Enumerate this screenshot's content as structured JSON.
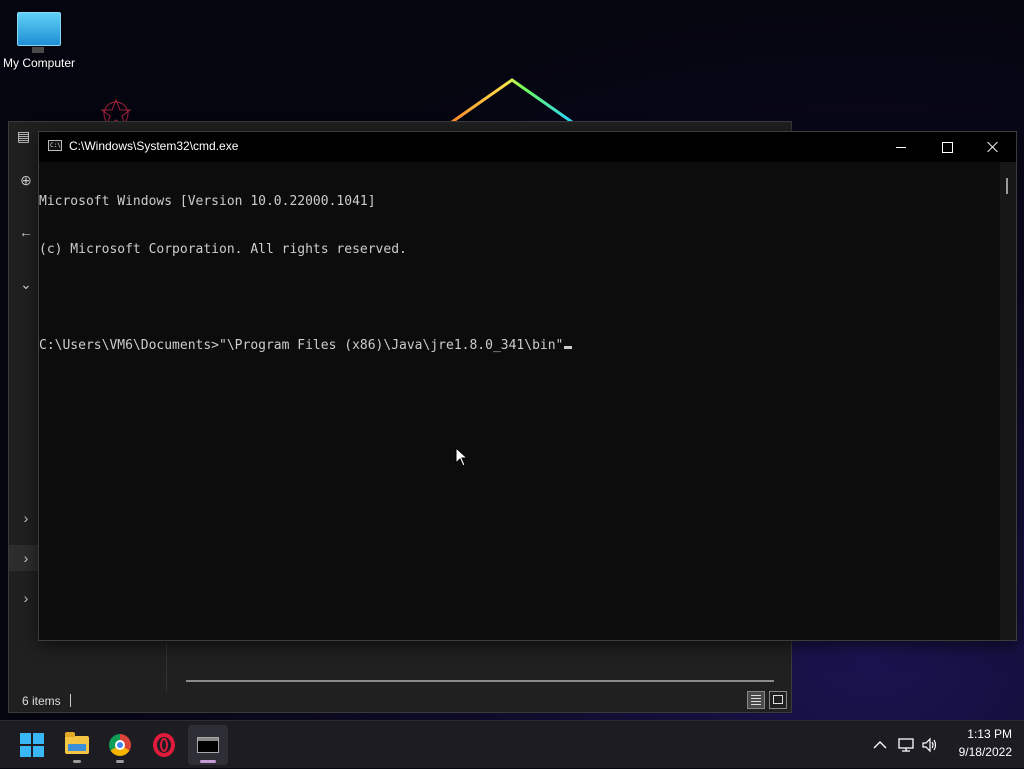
{
  "desktop": {
    "icons": [
      {
        "label": "My Computer",
        "icon": "monitor-icon"
      }
    ]
  },
  "explorer": {
    "status_items": "6 items",
    "view_buttons": [
      "details-view-icon",
      "large-icons-view-icon"
    ]
  },
  "cmd": {
    "title": "C:\\Windows\\System32\\cmd.exe",
    "icon_text": "C:\\",
    "lines": [
      "Microsoft Windows [Version 10.0.22000.1041]",
      "(c) Microsoft Corporation. All rights reserved.",
      "",
      "C:\\Users\\VM6\\Documents>\"\\Program Files (x86)\\Java\\jre1.8.0_341\\bin\""
    ]
  },
  "taskbar": {
    "apps": [
      "start-icon",
      "file-explorer-icon",
      "chrome-icon",
      "opera-icon",
      "command-prompt-icon"
    ],
    "time": "1:13 PM",
    "date": "9/18/2022"
  },
  "colors": {
    "console_text": "#cccccc",
    "console_bg": "#0c0c0c",
    "accent_blue": "#38b6f5",
    "active_indicator": "#c79ad6"
  }
}
